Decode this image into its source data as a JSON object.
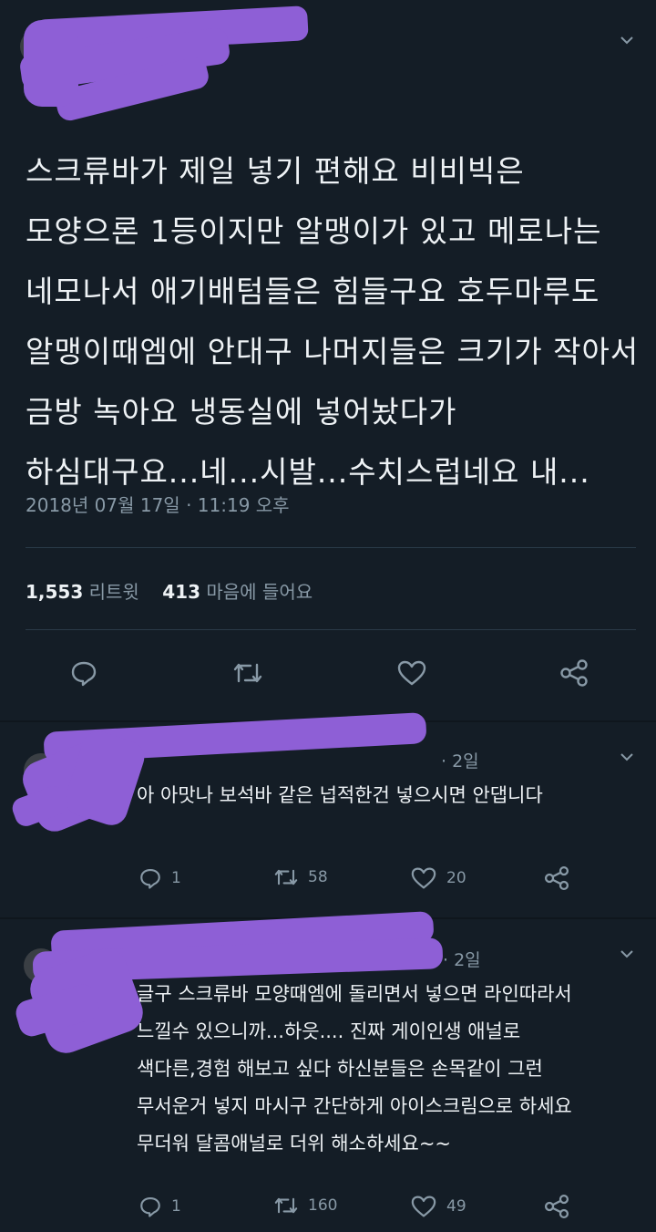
{
  "tweet": {
    "lines": [
      "스크류바가 제일 넣기 편해요 비비빅은",
      "모양으론 1등이지만 알맹이가 있고 메로나는",
      "네모나서 애기배텀들은 힘들구요 호두마루도",
      "알맹이때엠에 안대구 나머지들은 크기가 작아서",
      "금방 녹아요 냉동실에 넣어놨다가",
      "하심대구요...네...시발...수치스럽네요 내..."
    ],
    "timestamp": "2018년 07월 17일 · 11:19 오후",
    "retweet_count": "1,553",
    "retweet_label": "리트윗",
    "like_count": "413",
    "like_label": "마음에 들어요"
  },
  "replies": [
    {
      "time": "· 2일",
      "lines": [
        "아 아맛나 보석바 같은 넙적한건 넣으시면 안댑니다"
      ],
      "reply_count": "1",
      "retweet_count": "58",
      "like_count": "20"
    },
    {
      "time": "· 2일",
      "lines": [
        "글구 스크류바 모양때엠에 돌리면서 넣으면 라인따라서",
        "느낄수 있으니까...하읏.... 진짜 게이인생 애널로",
        "색다른,경험 해보고 싶다 하신분들은 손목같이 그런",
        "무서운거 넣지 마시구 간단하게 아이스크림으로 하세요",
        "무더워 달콤애널로 더위 해소하세요~~"
      ],
      "reply_count": "1",
      "retweet_count": "160",
      "like_count": "49"
    }
  ],
  "icons": {
    "reply": "reply-icon",
    "retweet": "retweet-icon",
    "like": "heart-icon",
    "share": "share-icon",
    "more": "chevron-down-icon"
  },
  "colors": {
    "background": "#141d26",
    "text": "#eef2f5",
    "muted": "#8899a6",
    "redaction": "#8e5fd6"
  }
}
